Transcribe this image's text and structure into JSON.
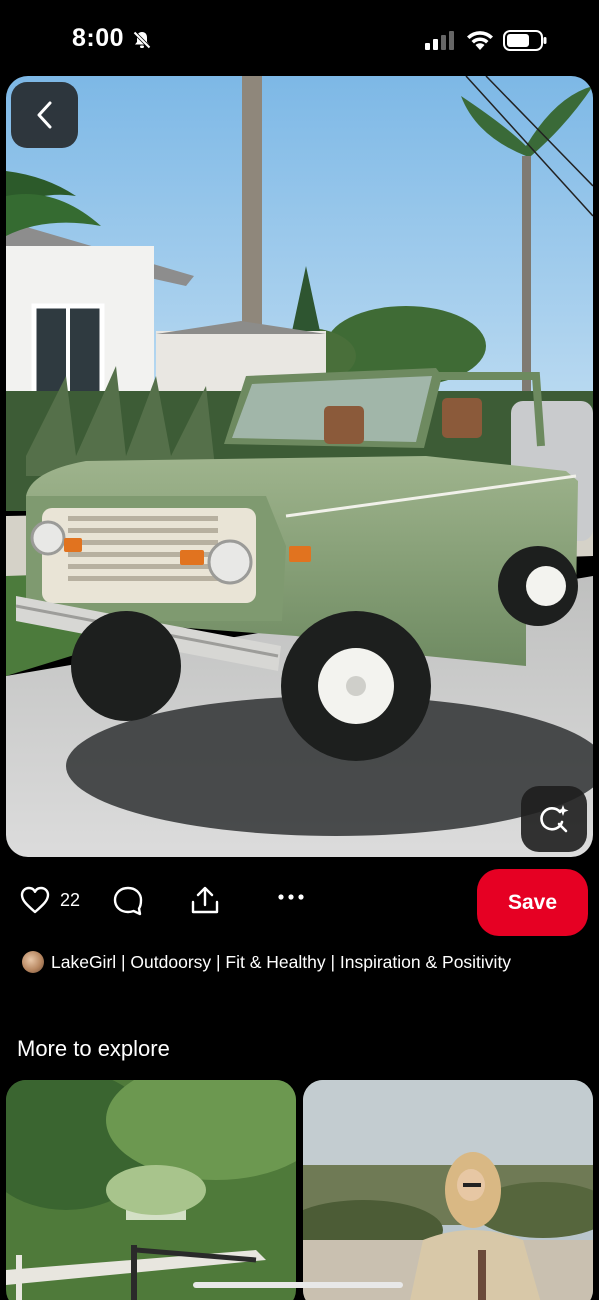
{
  "status_bar": {
    "time": "8:00",
    "icons": [
      "bell-slash-icon",
      "cellular-signal-icon",
      "wifi-icon",
      "battery-icon"
    ]
  },
  "pin": {
    "image_icon_buttons": [
      "back-chevron-icon",
      "visual-search-icon"
    ],
    "like_count": "22",
    "save_label": "Save",
    "author": "LakeGirl | Outdoorsy | Fit & Healthy | Inspiration & Positivity"
  },
  "explore": {
    "title": "More to explore"
  },
  "colors": {
    "save": "#e60023",
    "background": "#000000",
    "vehicle_green": "#7f9a70"
  }
}
